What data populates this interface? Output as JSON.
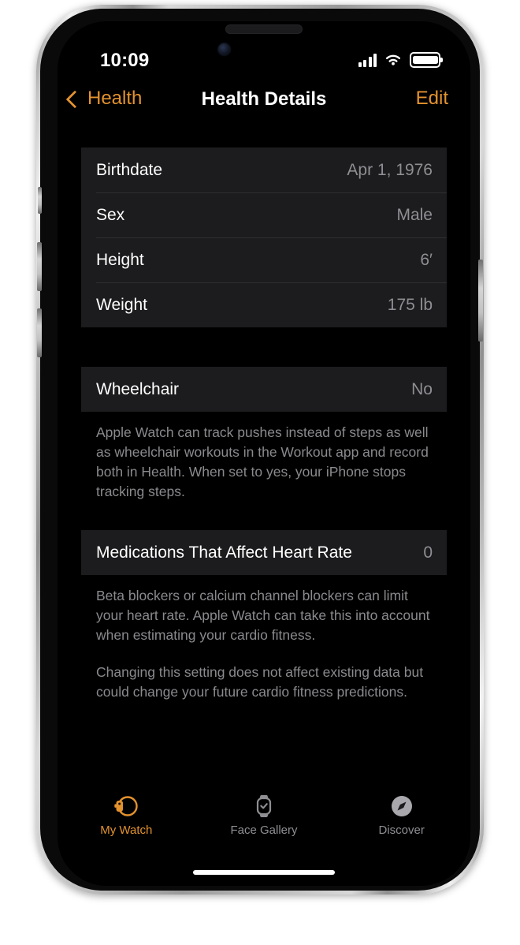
{
  "status_bar": {
    "time": "10:09",
    "signal_icon": "cellular-signal-icon",
    "wifi_icon": "wifi-icon",
    "battery_icon": "battery-full-icon"
  },
  "nav": {
    "back_label": "Health",
    "back_icon": "chevron-left-icon",
    "title": "Health Details",
    "edit_label": "Edit"
  },
  "accent_color": "#e3922e",
  "profile_section": {
    "rows": [
      {
        "label": "Birthdate",
        "value": "Apr 1, 1976"
      },
      {
        "label": "Sex",
        "value": "Male"
      },
      {
        "label": "Height",
        "value": "6′"
      },
      {
        "label": "Weight",
        "value": "175 lb"
      }
    ]
  },
  "wheelchair_section": {
    "row": {
      "label": "Wheelchair",
      "value": "No"
    },
    "footer": "Apple Watch can track pushes instead of steps as well as wheelchair workouts in the Workout app and record both in Health. When set to yes, your iPhone stops tracking steps."
  },
  "medications_section": {
    "row": {
      "label": "Medications That Affect Heart Rate",
      "value": "0"
    },
    "footer_paragraph_1": "Beta blockers or calcium channel blockers can limit your heart rate. Apple Watch can take this into account when estimating your cardio fitness.",
    "footer_paragraph_2": "Changing this setting does not affect existing data but could change your future cardio fitness predictions."
  },
  "tab_bar": {
    "tabs": [
      {
        "label": "My Watch",
        "icon": "watch-side-icon",
        "active": true
      },
      {
        "label": "Face Gallery",
        "icon": "watch-face-icon",
        "active": false
      },
      {
        "label": "Discover",
        "icon": "compass-icon",
        "active": false
      }
    ]
  }
}
